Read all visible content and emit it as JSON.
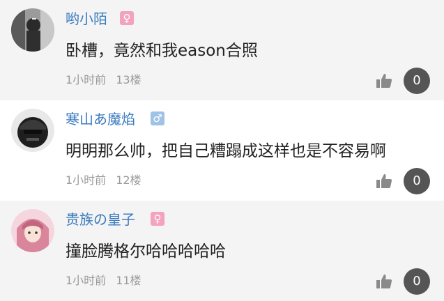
{
  "comments": [
    {
      "username": "哟小陌",
      "gender": "female",
      "gender_symbol": "♀",
      "content": "卧槽，竟然和我eason合照",
      "time": "1小时前",
      "floor": "13楼",
      "likes": "0",
      "avatar_icon": "avatar-photo-icon"
    },
    {
      "username": "寒山あ魔焰",
      "gender": "male",
      "gender_symbol": "♂",
      "content": "明明那么帅，把自己糟蹋成这样也是不容易啊",
      "time": "1小时前",
      "floor": "12楼",
      "likes": "0",
      "avatar_icon": "avatar-photo-icon"
    },
    {
      "username": "贵族の皇子",
      "gender": "female",
      "gender_symbol": "♀",
      "content": "撞脸腾格尔哈哈哈哈哈",
      "time": "1小时前",
      "floor": "11楼",
      "likes": "0",
      "avatar_icon": "avatar-photo-icon"
    }
  ],
  "colors": {
    "username": "#3b7bbf",
    "female_badge": "#f3a3bd",
    "male_badge": "#9ec3e6",
    "like_badge": "#555555",
    "meta_text": "#9a9a9a"
  },
  "icons": {
    "like": "thumbs-up-icon"
  }
}
